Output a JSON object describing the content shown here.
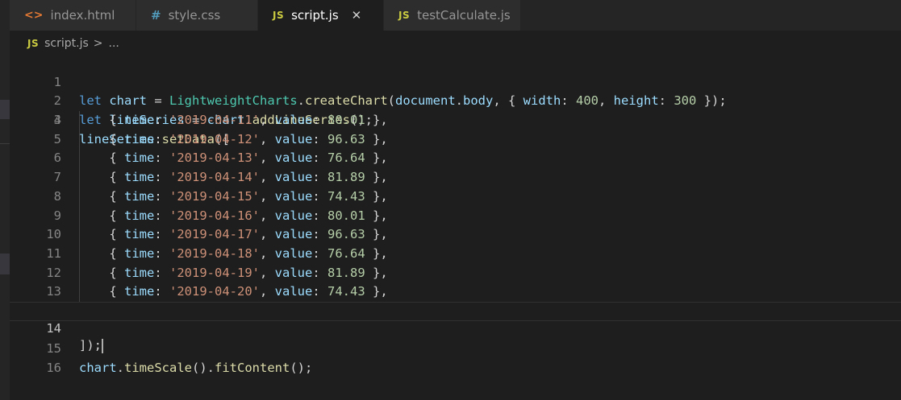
{
  "tabs": [
    {
      "label": "index.html",
      "icon": "html-icon",
      "glyph": "<>",
      "active": false
    },
    {
      "label": "style.css",
      "icon": "css-icon",
      "glyph": "#",
      "active": false
    },
    {
      "label": "script.js",
      "icon": "js-icon",
      "glyph": "JS",
      "active": true,
      "close": "✕"
    },
    {
      "label": "testCalculate.js",
      "icon": "js-icon",
      "glyph": "JS",
      "active": false
    }
  ],
  "breadcrumb": {
    "glyph": "JS",
    "file": "script.js",
    "separator": ">",
    "rest": "..."
  },
  "editor": {
    "current_line": 14,
    "line_numbers": [
      "1",
      "2",
      "3",
      "4",
      "5",
      "6",
      "7",
      "8",
      "9",
      "10",
      "11",
      "12",
      "13",
      "14",
      "15",
      "16"
    ],
    "line1": {
      "k": "let",
      "v": "chart",
      "eq": " = ",
      "cls": "LightweightCharts",
      "dot": ".",
      "fn": "createChart",
      "open": "(",
      "doc": "document",
      "dot2": ".",
      "body": "body",
      "c1": ", { ",
      "wk": "width",
      "col": ": ",
      "wv": "400",
      "c2": ", ",
      "hk": "height",
      "col2": ": ",
      "hv": "300",
      "close": " });"
    },
    "line2": {
      "k": "let",
      "v": "lineSeries",
      "eq": " = ",
      "obj": "chart",
      "dot": ".",
      "fn": "addLineSeries",
      "close": "();"
    },
    "line3": {
      "obj": "lineSeries",
      "dot": ".",
      "fn": "setData",
      "close": "(["
    },
    "data_rows": [
      {
        "time": "'2019-04-11'",
        "value": "80.01"
      },
      {
        "time": "'2019-04-12'",
        "value": "96.63"
      },
      {
        "time": "'2019-04-13'",
        "value": "76.64"
      },
      {
        "time": "'2019-04-14'",
        "value": "81.89"
      },
      {
        "time": "'2019-04-15'",
        "value": "74.43"
      },
      {
        "time": "'2019-04-16'",
        "value": "80.01"
      },
      {
        "time": "'2019-04-17'",
        "value": "96.63"
      },
      {
        "time": "'2019-04-18'",
        "value": "76.64"
      },
      {
        "time": "'2019-04-19'",
        "value": "81.89"
      },
      {
        "time": "'2019-04-20'",
        "value": "74.43"
      }
    ],
    "row_tokens": {
      "open": "{ ",
      "time_key": "time",
      "colon": ": ",
      "comma": ", ",
      "value_key": "value",
      "close": " },"
    },
    "line14": "]);",
    "line15": {
      "obj": "chart",
      "dot": ".",
      "fn": "timeScale",
      "mid": "().",
      "fn2": "fitContent",
      "close": "();"
    }
  }
}
